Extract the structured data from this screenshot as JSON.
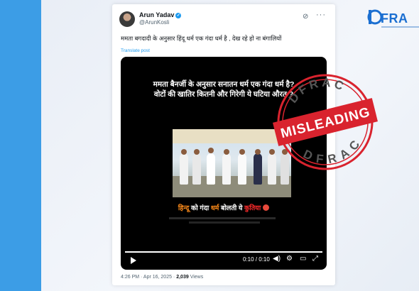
{
  "tweet": {
    "author_name": "Arun Yadav",
    "author_handle": "@ArunKosli",
    "text": "ममता बगदादी के अनुसार हिंदू धर्म एक गंदा धर्म है , देख रहे हो ना बंगालियों",
    "translate_label": "Translate post",
    "timestamp": "4:26 PM · Apr 16, 2025 · ",
    "views_count": "2,039",
    "views_label": " Views"
  },
  "video": {
    "overlay_text": "ममता बैनर्जी के अनुसार सनातन धर्म एक गंदा धर्म है? वोटों की खातिर कितनी और गिरेगी ये घटिया औरत ?",
    "subtitle_part1": "हिन्दू",
    "subtitle_part2": " को गंदा ",
    "subtitle_part3": "धर्म",
    "subtitle_part4": " बोलती ये ",
    "subtitle_part5": "कुतिया",
    "time": "0:10 / 0:10",
    "progress": 1.0
  },
  "stamp": {
    "top_text": "DFRAC",
    "bottom_text": "DFRAC",
    "label": "MISLEADING",
    "color": "#d9232e"
  },
  "logo": {
    "text": "FRA",
    "color": "#1b6fd1"
  },
  "icons": [
    "verified-badge-icon",
    "grok-icon",
    "more-icon",
    "play-icon",
    "volume-icon",
    "settings-icon",
    "expand-icon",
    "fullscreen-icon"
  ]
}
